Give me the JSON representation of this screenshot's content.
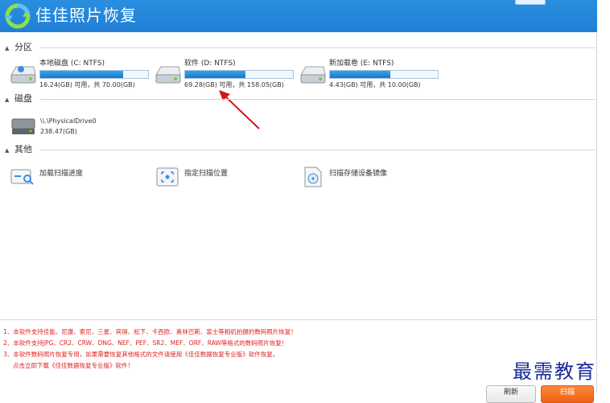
{
  "app": {
    "title": "佳佳照片恢复"
  },
  "sections": {
    "partitions": "分区",
    "disks": "磁盘",
    "other": "其他"
  },
  "partitions": [
    {
      "name": "本地磁盘 (C: NTFS)",
      "info": "16.24(GB) 可用，共 70.00(GB)",
      "used_fraction": 0.77
    },
    {
      "name": "软件 (D: NTFS)",
      "info": "69.28(GB) 可用，共 158.05(GB)",
      "used_fraction": 0.56
    },
    {
      "name": "新加载卷 (E: NTFS)",
      "info": "4.43(GB) 可用，共 10.00(GB)",
      "used_fraction": 0.56
    }
  ],
  "disks": [
    {
      "name": "\\\\.\\PhysicalDrive0",
      "size": "238.47(GB)"
    }
  ],
  "other_items": [
    {
      "label": "加载扫描进度",
      "icon": "load-progress-icon"
    },
    {
      "label": "指定扫描位置",
      "icon": "scan-location-icon"
    },
    {
      "label": "扫描存储设备镜像",
      "icon": "disk-image-icon"
    }
  ],
  "notes": [
    "1、本软件支持佳能、尼康、索尼、三星、宾得、松下、卡西欧、奥林巴斯、富士等相机拍摄的数码照片恢复！",
    "2、本软件支持JPG、CR2、CRW、DNG、NEF、PEF、SR2、MEF、ORF、RAW等格式的数码照片恢复！",
    "3、本软件数码照片恢复专用，如果需要恢复其他格式的文件请使用《佳佳数据恢复专业版》软件恢复。",
    "点击立即下载《佳佳数据恢复专业版》软件！"
  ],
  "watermark": "最需教育",
  "buttons": {
    "refresh": "刷新",
    "scan": "扫描"
  },
  "colors": {
    "titlebar": "#1f7fd6",
    "bar_fill": "#1977c9",
    "notes": "#e02020",
    "scan_button": "#f06010",
    "arrow": "#d01818"
  }
}
